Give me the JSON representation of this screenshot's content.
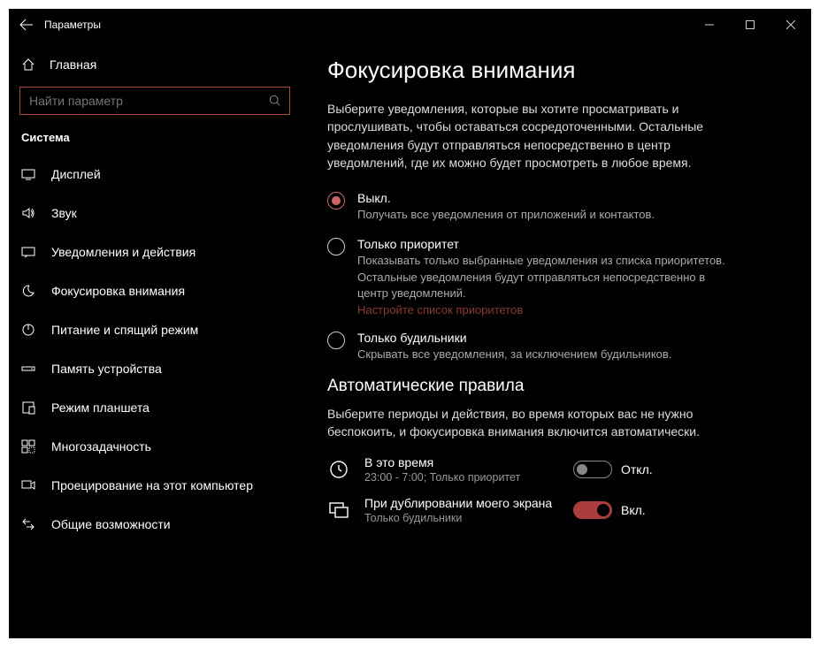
{
  "window": {
    "title": "Параметры"
  },
  "sidebar": {
    "home": "Главная",
    "search_placeholder": "Найти параметр",
    "category": "Система",
    "items": [
      {
        "label": "Дисплей"
      },
      {
        "label": "Звук"
      },
      {
        "label": "Уведомления и действия"
      },
      {
        "label": "Фокусировка внимания"
      },
      {
        "label": "Питание и спящий режим"
      },
      {
        "label": "Память устройства"
      },
      {
        "label": "Режим планшета"
      },
      {
        "label": "Многозадачность"
      },
      {
        "label": "Проецирование на этот компьютер"
      },
      {
        "label": "Общие возможности"
      }
    ]
  },
  "page": {
    "title": "Фокусировка внимания",
    "description": "Выберите уведомления, которые вы хотите просматривать и прослушивать, чтобы оставаться сосредоточенными. Остальные уведомления будут отправляться непосредственно в центр уведомлений, где их можно будет просмотреть в любое время.",
    "radios": {
      "off": {
        "title": "Выкл.",
        "sub": "Получать все уведомления от приложений и контактов."
      },
      "priority": {
        "title": "Только приоритет",
        "sub": "Показывать только выбранные уведомления из списка приоритетов. Остальные уведомления будут отправляться непосредственно в центр уведомлений.",
        "link": "Настройте список приоритетов"
      },
      "alarms": {
        "title": "Только будильники",
        "sub": "Скрывать все уведомления, за исключением будильников."
      }
    },
    "auto_rules": {
      "title": "Автоматические правила",
      "description": "Выберите периоды и действия, во время которых вас не нужно беспокоить, и фокусировка внимания включится автоматически.",
      "time": {
        "title": "В это время",
        "sub": "23:00 - 7:00; Только приоритет",
        "state": "Откл."
      },
      "duplicate": {
        "title": "При дублировании моего экрана",
        "sub": "Только будильники",
        "state": "Вкл."
      }
    }
  }
}
